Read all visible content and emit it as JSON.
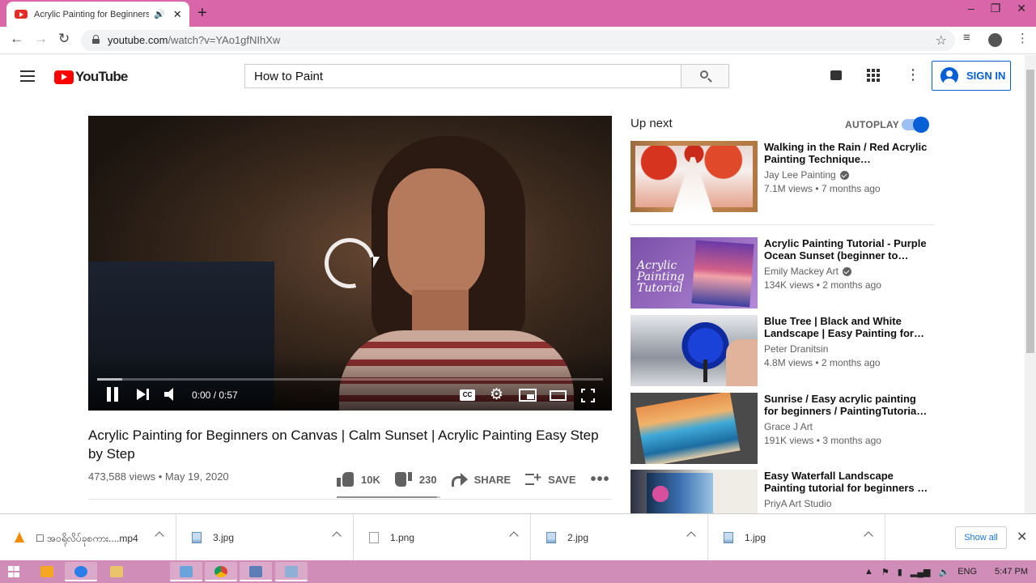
{
  "browser": {
    "tab_title": "Acrylic Painting for Beginners on Canvas | Calm Sunset | Acrylic Painting Easy Step by Step",
    "url_host": "youtube.com",
    "url_path": "/watch?v=YAo1gfNIhXw",
    "window_controls": [
      "–",
      "❐",
      "✕"
    ]
  },
  "youtube": {
    "logo_text": "YouTube",
    "search_value": "How to Paint",
    "signin_label": "SIGN IN"
  },
  "player": {
    "timecode": "0:00 / 0:57",
    "cc_label": "CC",
    "progress_buffered_pct": 5
  },
  "video": {
    "title": "Acrylic Painting for Beginners on Canvas | Calm Sunset | Acrylic Painting Easy Step by Step",
    "meta": "473,588 views • May 19, 2020",
    "likes": "10K",
    "dislikes": "230",
    "share_label": "SHARE",
    "save_label": "SAVE",
    "like_ratio_pct": 97
  },
  "sidebar": {
    "upnext_label": "Up next",
    "autoplay_label": "AUTOPLAY",
    "autoplay_on": true,
    "recommendations": [
      {
        "title": "Walking in the Rain / Red Acrylic Painting Technique…",
        "channel": "Jay Lee Painting",
        "verified": true,
        "meta": "7.1M views • 7 months ago"
      },
      {
        "title": "Acrylic Painting Tutorial - Purple Ocean Sunset (beginner to…",
        "channel": "Emily Mackey Art",
        "verified": true,
        "meta": "134K views • 2 months ago",
        "thumb_text": "Acrylic Painting Tutorial"
      },
      {
        "title": "Blue Tree | Black and White Landscape | Easy Painting for…",
        "channel": "Peter Dranitsin",
        "verified": false,
        "meta": "4.8M views • 2 months ago"
      },
      {
        "title": "Sunrise / Easy acrylic painting for beginners / PaintingTutoria…",
        "channel": "Grace J Art",
        "verified": false,
        "meta": "191K views • 3 months ago"
      },
      {
        "title": "Easy Waterfall Landscape Painting tutorial for beginners …",
        "channel": "PriyA Art Studio",
        "verified": false,
        "meta": ""
      }
    ]
  },
  "downloads": {
    "items": [
      {
        "name": "☐ အဝရိုလိပ်ခုစကား....mp4",
        "icon": "vlc-icon"
      },
      {
        "name": "3.jpg",
        "icon": "image-file-icon"
      },
      {
        "name": "1.png",
        "icon": "png-file-icon"
      },
      {
        "name": "2.jpg",
        "icon": "image-file-icon"
      },
      {
        "name": "1.jpg",
        "icon": "image-file-icon"
      }
    ],
    "show_all_label": "Show all"
  },
  "taskbar": {
    "language": "ENG",
    "clock": "5:47 PM"
  }
}
